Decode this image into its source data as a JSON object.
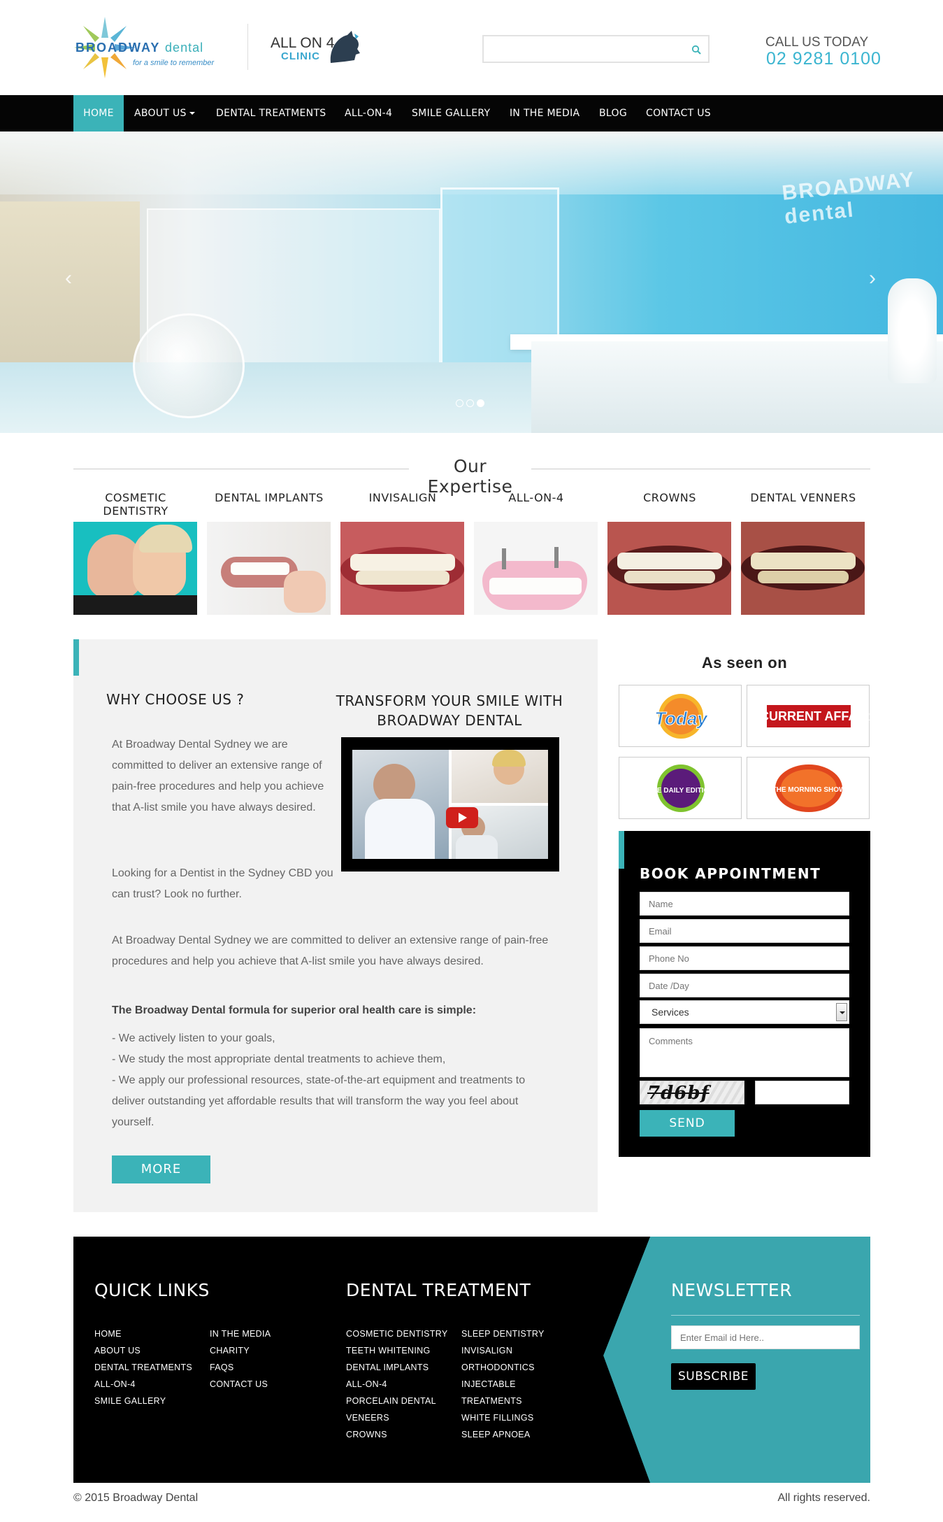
{
  "header": {
    "logo_brand": "BROADWAY",
    "logo_brand_suffix": "dental",
    "logo_tagline": "for a smile to remember",
    "partner_top": "ALL ON 4",
    "partner_bottom": "CLINIC",
    "search_placeholder": "",
    "call_label": "CALL US TODAY",
    "call_number": "02 9281 0100"
  },
  "nav": {
    "items": [
      {
        "label": "HOME",
        "active": true
      },
      {
        "label": "ABOUT US",
        "dropdown": true
      },
      {
        "label": "DENTAL TREATMENTS"
      },
      {
        "label": "ALL-ON-4"
      },
      {
        "label": "SMILE GALLERY"
      },
      {
        "label": "IN THE MEDIA"
      },
      {
        "label": "BLOG"
      },
      {
        "label": "CONTACT US"
      }
    ]
  },
  "hero": {
    "sign_text": "BROADWAY dental",
    "slides_total": 3,
    "active_slide": 3,
    "prev_icon": "chevron-left-icon",
    "next_icon": "chevron-right-icon"
  },
  "expertise": {
    "title": "Our Expertise",
    "items": [
      {
        "label": "COSMETIC DENTISTRY"
      },
      {
        "label": "DENTAL IMPLANTS"
      },
      {
        "label": "INVISALIGN"
      },
      {
        "label": "ALL-ON-4"
      },
      {
        "label": "CROWNS"
      },
      {
        "label": "DENTAL VENNERS"
      }
    ]
  },
  "why": {
    "title": "WHY CHOOSE US ?",
    "para1": "At Broadway Dental Sydney we are committed to deliver an extensive range of pain-free procedures and help you achieve that A-list smile you have always desired.",
    "para2": "Looking for a Dentist in the Sydney CBD you can trust? Look no further.",
    "para3": "At Broadway Dental Sydney we are committed to deliver an extensive range of pain-free procedures and help you achieve that A-list smile you have always desired.",
    "formula": "The Broadway Dental formula for superior oral health care is simple:",
    "bullets": [
      "- We actively listen to your goals,",
      "- We study the most appropriate dental treatments to achieve them,",
      "- We apply our professional resources, state-of-the-art equipment and treatments to deliver outstanding yet affordable results that will transform the way you feel about yourself."
    ],
    "more_label": "MORE"
  },
  "transform": {
    "title": "TRANSFORM YOUR SMILE WITH BROADWAY DENTAL",
    "video_icon": "play-icon"
  },
  "seen_on": {
    "title": "As seen on",
    "logos": [
      {
        "name": "Today"
      },
      {
        "name": "A CURRENT AFFAIR"
      },
      {
        "name": "THE DAILY EDITION"
      },
      {
        "name": "THE MORNING SHOW"
      }
    ]
  },
  "book": {
    "title": "BOOK APPOINTMENT",
    "name_placeholder": "Name",
    "email_placeholder": "Email",
    "phone_placeholder": "Phone No",
    "date_placeholder": "Date /Day",
    "services_selected": "Services",
    "comments_placeholder": "Comments",
    "captcha_text": "7d6bf",
    "send_label": "SEND"
  },
  "footer": {
    "quick_links_title": "QUICK LINKS",
    "quick_links_col1": [
      "HOME",
      "ABOUT US",
      "DENTAL TREATMENTS",
      "ALL-ON-4",
      "SMILE GALLERY"
    ],
    "quick_links_col2": [
      "IN THE MEDIA",
      "CHARITY",
      "FAQS",
      "CONTACT US"
    ],
    "treatment_title": "DENTAL TREATMENT",
    "treatment_col1": [
      "COSMETIC DENTISTRY",
      "TEETH WHITENING",
      "DENTAL IMPLANTS",
      "ALL-ON-4",
      "PORCELAIN DENTAL",
      "VENEERS",
      "CROWNS"
    ],
    "treatment_col2": [
      "SLEEP DENTISTRY",
      "INVISALIGN",
      "ORTHODONTICS",
      "INJECTABLE",
      "TREATMENTS",
      "WHITE FILLINGS",
      "SLEEP APNOEA"
    ],
    "newsletter_title": "NEWSLETTER",
    "newsletter_placeholder": "Enter Email id Here..",
    "subscribe_label": "SUBSCRIBE",
    "copyright": "© 2015 Broadway Dental",
    "rights": "All rights reserved."
  },
  "colors": {
    "accent": "#3bb3b8",
    "nav_bg": "#050505",
    "phone": "#3bb5d0"
  }
}
